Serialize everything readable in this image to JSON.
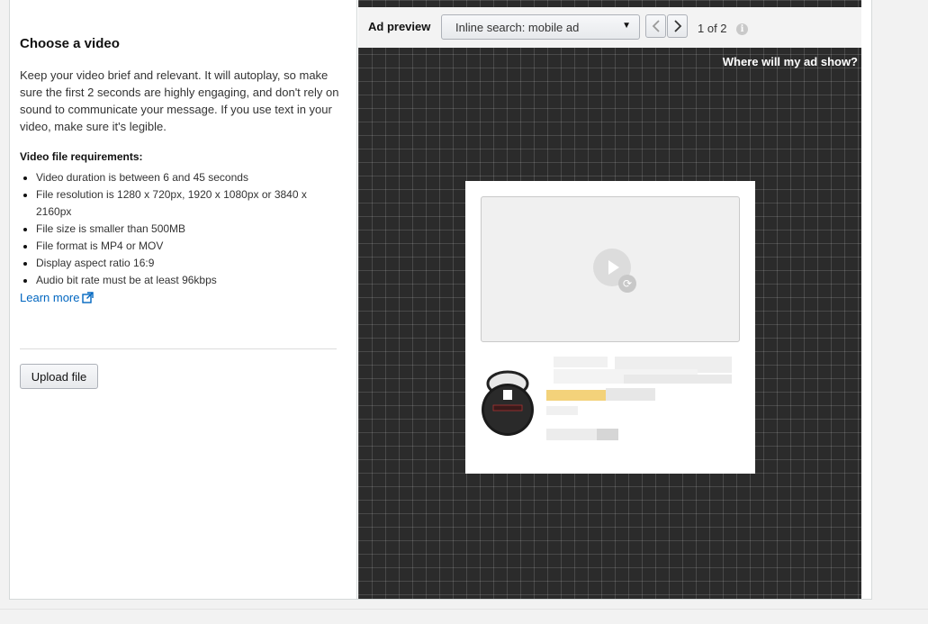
{
  "left_panel": {
    "title": "Choose a video",
    "description": "Keep your video brief and relevant. It will autoplay, so make sure the first 2 seconds are highly engaging, and don't rely on sound to communicate your message. If you use text in your video, make sure it's legible.",
    "requirements_title": "Video file requirements:",
    "requirements": [
      "Video duration is between 6 and 45 seconds",
      "File resolution is 1280 x 720px, 1920 x 1080px or 3840 x 2160px",
      "File size is smaller than 500MB",
      "File format is MP4 or MOV",
      "Display aspect ratio 16:9",
      "Audio bit rate must be at least 96kbps"
    ],
    "learn_more": "Learn more",
    "upload_button": "Upload file"
  },
  "preview": {
    "label": "Ad preview",
    "placement_select": "Inline search: mobile ad",
    "counter": "1 of 2",
    "where_link": "Where will my ad show?",
    "info_icon": "info-icon",
    "prev_icon": "chevron-left-icon",
    "next_icon": "chevron-right-icon"
  },
  "colors": {
    "link": "#0066c0",
    "preview_bg": "#2b2b2b",
    "rating_bar": "#f3d27a"
  }
}
